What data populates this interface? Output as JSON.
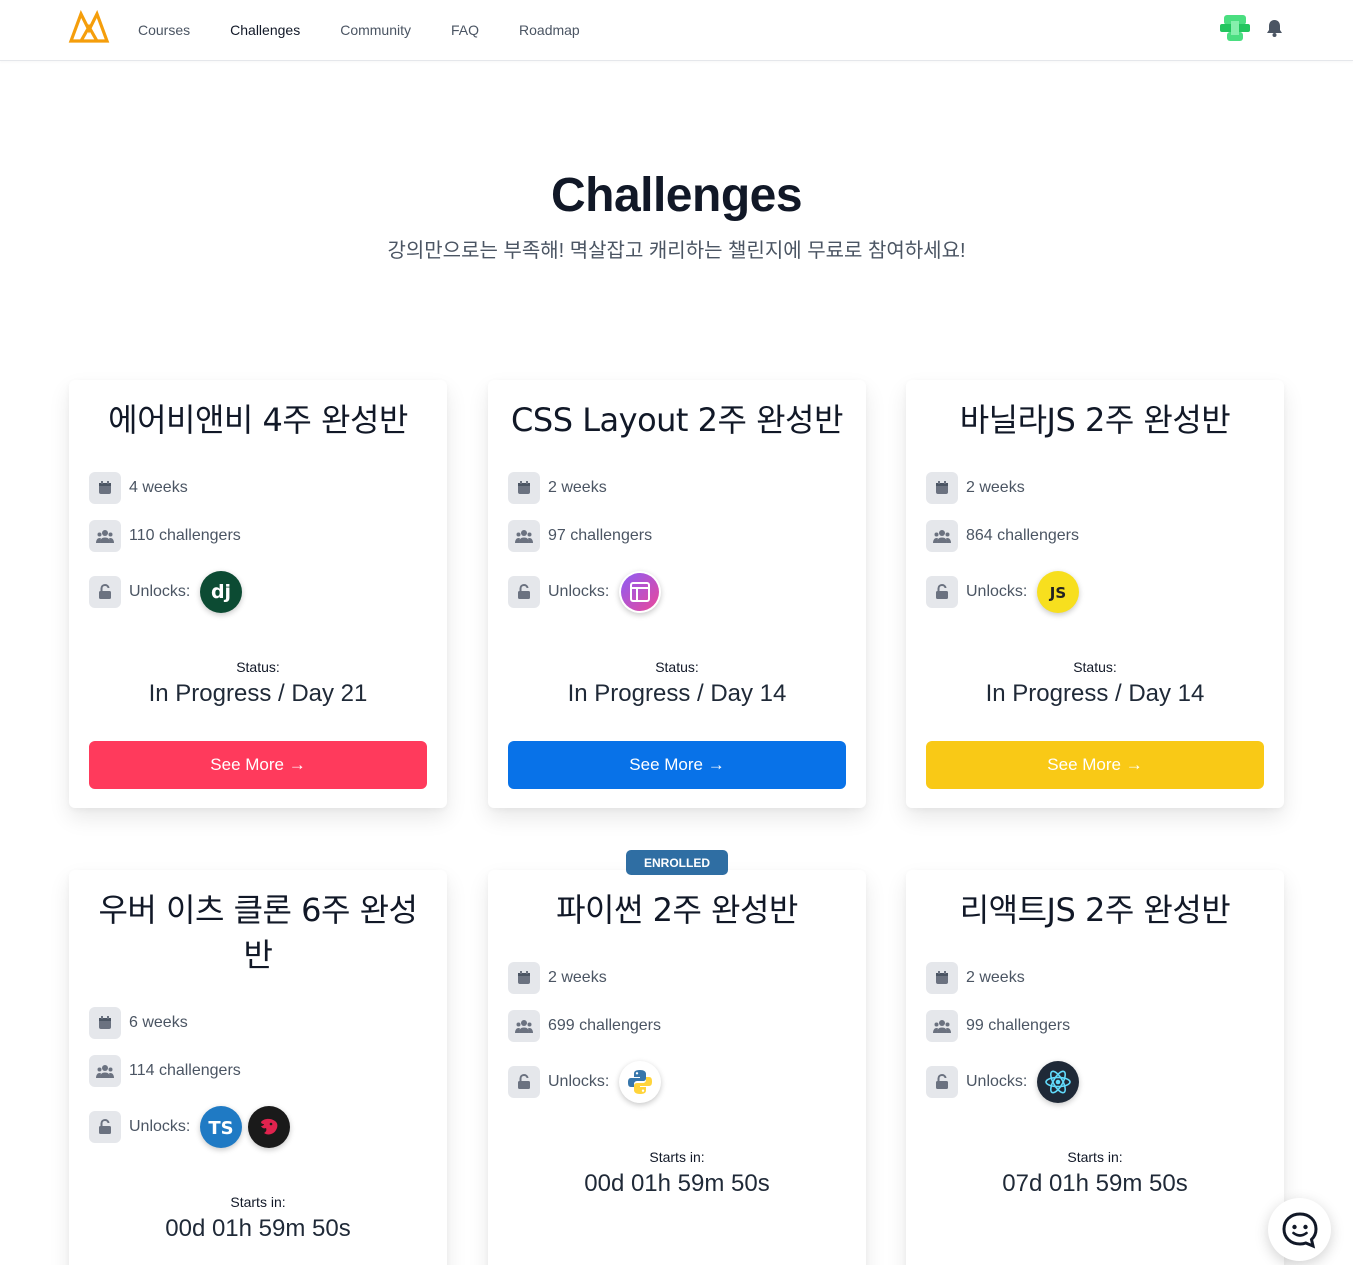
{
  "nav": {
    "links": [
      {
        "label": "Courses"
      },
      {
        "label": "Challenges"
      },
      {
        "label": "Community"
      },
      {
        "label": "FAQ"
      },
      {
        "label": "Roadmap"
      }
    ],
    "active": "Challenges"
  },
  "header": {
    "title": "Challenges",
    "subtitle": "강의만으로는 부족해! 멱살잡고 캐리하는 챌린지에 무료로 참여하세요!"
  },
  "unlocks_label": "Unlocks:",
  "see_more_label": "See More →",
  "enrolled_label": "ENROLLED",
  "cards": [
    {
      "title": "에어비앤비 4주 완성반",
      "duration": "4 weeks",
      "challengers": "110 challengers",
      "unlocks": [
        "django-icon"
      ],
      "status_label": "Status:",
      "status_value": "In Progress / Day 21",
      "button_color": "#ff3a5c"
    },
    {
      "title": "CSS Layout 2주 완성반",
      "duration": "2 weeks",
      "challengers": "97 challengers",
      "unlocks": [
        "css-layout-icon"
      ],
      "status_label": "Status:",
      "status_value": "In Progress / Day 14",
      "button_color": "#0872e8"
    },
    {
      "title": "바닐라JS 2주 완성반",
      "duration": "2 weeks",
      "challengers": "864 challengers",
      "unlocks": [
        "javascript-icon"
      ],
      "status_label": "Status:",
      "status_value": "In Progress / Day 14",
      "button_color": "#f9c916"
    },
    {
      "title": "우버 이츠 클론 6주 완성반",
      "duration": "6 weeks",
      "challengers": "114 challengers",
      "unlocks": [
        "typescript-icon",
        "nestjs-icon"
      ],
      "status_label": "Starts in:",
      "status_value": "00d 01h 59m 50s"
    },
    {
      "title": "파이썬 2주 완성반",
      "duration": "2 weeks",
      "challengers": "699 challengers",
      "unlocks": [
        "python-icon"
      ],
      "status_label": "Starts in:",
      "status_value": "00d 01h 59m 50s"
    },
    {
      "title": "리액트JS 2주 완성반",
      "duration": "2 weeks",
      "challengers": "99 challengers",
      "unlocks": [
        "react-icon"
      ],
      "status_label": "Starts in:",
      "status_value": "07d 01h 59m 50s"
    }
  ]
}
